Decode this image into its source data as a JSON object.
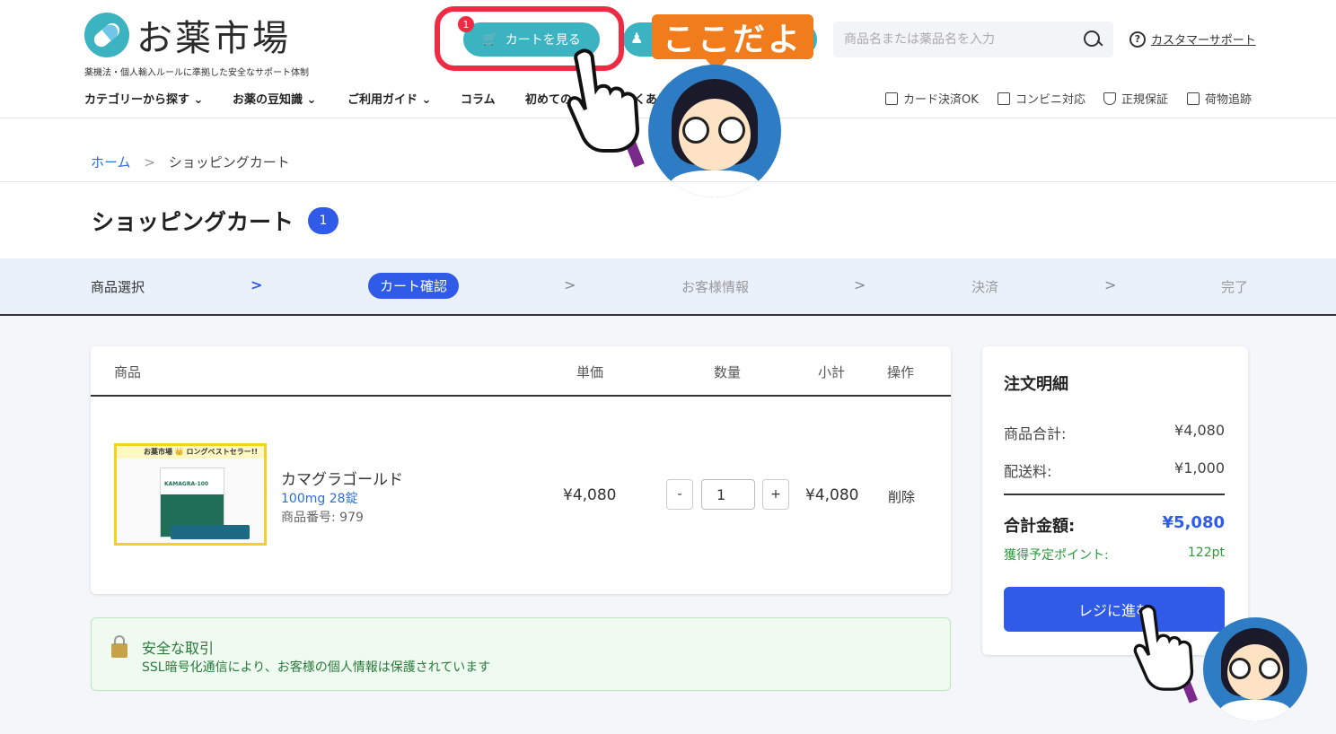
{
  "header": {
    "logo_text": "お薬市場",
    "tagline": "薬機法・個人輸入ルールに準拠した安全なサポート体制",
    "cart_button": "カートを見る",
    "cart_count": "1",
    "callout": "ここだよ",
    "search_placeholder": "商品名または薬品名を入力",
    "support": "カスタマーサポート"
  },
  "nav": {
    "items": [
      "カテゴリーから探す ⌄",
      "お薬の豆知識 ⌄",
      "ご利用ガイド ⌄",
      "コラム",
      "初めての",
      "くあ"
    ]
  },
  "features": [
    "カード決済OK",
    "コンビニ対応",
    "正規保証",
    "荷物追跡"
  ],
  "breadcrumb": {
    "home": "ホーム",
    "sep": ">",
    "current": "ショッピングカート"
  },
  "page": {
    "title": "ショッピングカート",
    "badge": "1"
  },
  "steps": {
    "labels": [
      "商品選択",
      "カート確認",
      "お客様情報",
      "決済",
      "完了"
    ],
    "arrow": ">"
  },
  "table": {
    "headers": {
      "product": "商品",
      "unit_price": "単価",
      "quantity": "数量",
      "subtotal": "小計",
      "action": "操作"
    },
    "rows": [
      {
        "img_banner": "お薬市場 👑 ロングベストセラー!!",
        "img_brand": "KAMAGRA-100",
        "name": "カマグラゴールド",
        "variant": "100mg 28錠",
        "sku": "商品番号: 979",
        "unit_price": "¥4,080",
        "qty": "1",
        "minus": "-",
        "plus": "+",
        "subtotal": "¥4,080",
        "delete": "削除"
      }
    ]
  },
  "secure": {
    "title": "安全な取引",
    "text": "SSL暗号化通信により、お客様の個人情報は保護されています"
  },
  "summary": {
    "title": "注文明細",
    "items_label": "商品合計:",
    "items_value": "¥4,080",
    "shipping_label": "配送料:",
    "shipping_value": "¥1,000",
    "total_label": "合計金額:",
    "total_value": "¥5,080",
    "points_label": "獲得予定ポイント:",
    "points_value": "122pt",
    "checkout": "レジに進む"
  },
  "colors": {
    "accent": "#2f5be8",
    "teal": "#3bb3c0",
    "highlight": "#ee2b44",
    "callout": "#f07c1b"
  }
}
